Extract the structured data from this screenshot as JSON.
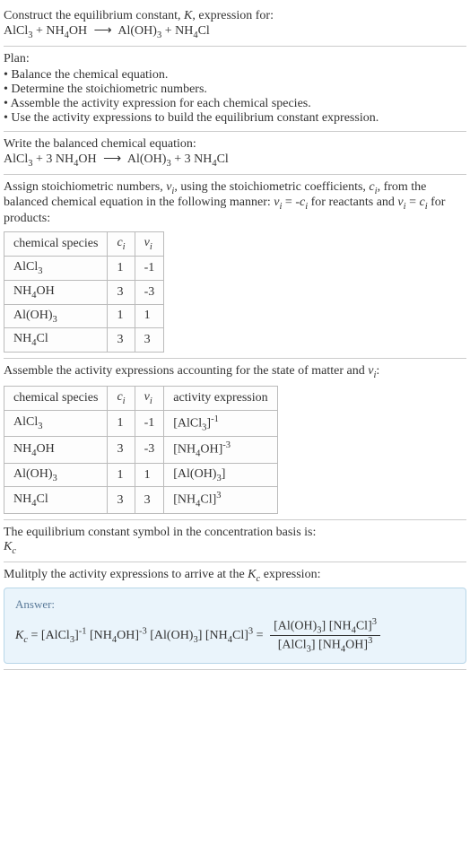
{
  "header": {
    "line1": "Construct the equilibrium constant, K, expression for:",
    "equation": "AlCl₃ + NH₄OH ⟶ Al(OH)₃ + NH₄Cl"
  },
  "plan": {
    "title": "Plan:",
    "items": [
      "Balance the chemical equation.",
      "Determine the stoichiometric numbers.",
      "Assemble the activity expression for each chemical species.",
      "Use the activity expressions to build the equilibrium constant expression."
    ]
  },
  "balanced": {
    "intro": "Write the balanced chemical equation:",
    "equation": "AlCl₃ + 3 NH₄OH ⟶ Al(OH)₃ + 3 NH₄Cl"
  },
  "stoich": {
    "intro": "Assign stoichiometric numbers, νᵢ, using the stoichiometric coefficients, cᵢ, from the balanced chemical equation in the following manner: νᵢ = -cᵢ for reactants and νᵢ = cᵢ for products:",
    "headers": [
      "chemical species",
      "cᵢ",
      "νᵢ"
    ],
    "rows": [
      {
        "species": "AlCl₃",
        "c": "1",
        "v": "-1"
      },
      {
        "species": "NH₄OH",
        "c": "3",
        "v": "-3"
      },
      {
        "species": "Al(OH)₃",
        "c": "1",
        "v": "1"
      },
      {
        "species": "NH₄Cl",
        "c": "3",
        "v": "3"
      }
    ]
  },
  "activity": {
    "intro": "Assemble the activity expressions accounting for the state of matter and νᵢ:",
    "headers": [
      "chemical species",
      "cᵢ",
      "νᵢ",
      "activity expression"
    ],
    "rows": [
      {
        "species": "AlCl₃",
        "c": "1",
        "v": "-1",
        "expr": "[AlCl₃]⁻¹"
      },
      {
        "species": "NH₄OH",
        "c": "3",
        "v": "-3",
        "expr": "[NH₄OH]⁻³"
      },
      {
        "species": "Al(OH)₃",
        "c": "1",
        "v": "1",
        "expr": "[Al(OH)₃]"
      },
      {
        "species": "NH₄Cl",
        "c": "3",
        "v": "3",
        "expr": "[NH₄Cl]³"
      }
    ]
  },
  "eqsymbol": {
    "intro": "The equilibrium constant symbol in the concentration basis is:",
    "symbol": "K_c"
  },
  "multiply": {
    "intro": "Mulitply the activity expressions to arrive at the K_c expression:"
  },
  "answer": {
    "label": "Answer:",
    "lhs": "K_c = [AlCl₃]⁻¹ [NH₄OH]⁻³ [Al(OH)₃] [NH₄Cl]³ =",
    "num": "[Al(OH)₃] [NH₄Cl]³",
    "den": "[AlCl₃] [NH₄OH]³"
  }
}
